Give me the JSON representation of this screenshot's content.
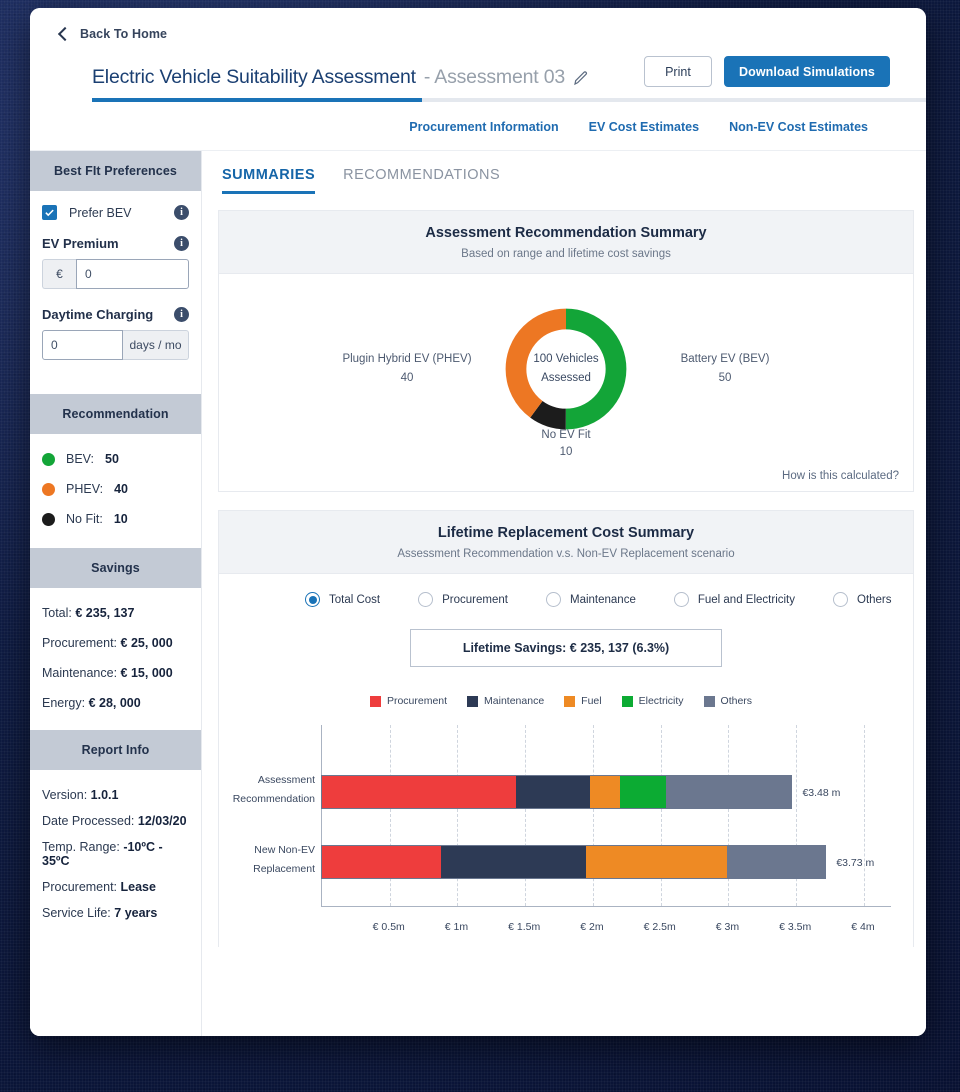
{
  "header": {
    "back_label": "Back To Home",
    "title_main": "Electric Vehicle Suitability Assessment",
    "title_sub": "- Assessment 03",
    "print_label": "Print",
    "download_label": "Download Simulations",
    "nav": [
      {
        "label": "Procurement Information"
      },
      {
        "label": "EV Cost Estimates"
      },
      {
        "label": "Non-EV Cost Estimates"
      }
    ]
  },
  "sidebar": {
    "preferences": {
      "title": "Best FIt Preferences",
      "prefer_bev_label": "Prefer BEV",
      "prefer_bev_checked": true,
      "ev_premium_label": "EV Premium",
      "ev_premium_currency": "€",
      "ev_premium_value": "0",
      "daytime_label": "Daytime Charging",
      "daytime_value": "0",
      "daytime_unit": "days / mo"
    },
    "recommendation": {
      "title": "Recommendation",
      "items": [
        {
          "label": "BEV:",
          "value": "50",
          "color": "#13a538"
        },
        {
          "label": "PHEV:",
          "value": "40",
          "color": "#ed7723"
        },
        {
          "label": "No Fit:",
          "value": "10",
          "color": "#1c1c1c"
        }
      ]
    },
    "savings": {
      "title": "Savings",
      "items": [
        {
          "label": "Total:",
          "value": "€ 235, 137"
        },
        {
          "label": "Procurement:",
          "value": "€ 25, 000"
        },
        {
          "label": "Maintenance:",
          "value": "€ 15, 000"
        },
        {
          "label": "Energy:",
          "value": "€ 28, 000"
        }
      ]
    },
    "report_info": {
      "title": "Report Info",
      "items": [
        {
          "label": "Version:",
          "value": "1.0.1"
        },
        {
          "label": "Date Processed:",
          "value": "12/03/20"
        },
        {
          "label": "Temp. Range:",
          "value": "-10ºC - 35ºC"
        },
        {
          "label": "Procurement:",
          "value": "Lease"
        },
        {
          "label": "Service Life:",
          "value": "7 years"
        }
      ]
    }
  },
  "main": {
    "tabs": [
      {
        "label": "SUMMARIES",
        "active": true
      },
      {
        "label": "RECOMMENDATIONS",
        "active": false
      }
    ],
    "panel1": {
      "title": "Assessment Recommendation Summary",
      "subtitle": "Based on range and lifetime cost savings",
      "calc_link": "How is this calculated?"
    },
    "panel2": {
      "title": "Lifetime Replacement Cost Summary",
      "subtitle": "Assessment Recommendation v.s. Non-EV Replacement scenario",
      "radios": [
        {
          "label": "Total Cost",
          "selected": true
        },
        {
          "label": "Procurement",
          "selected": false
        },
        {
          "label": "Maintenance",
          "selected": false
        },
        {
          "label": "Fuel and Electricity",
          "selected": false
        },
        {
          "label": "Others",
          "selected": false
        }
      ],
      "savings_box": "Lifetime Savings: € 235, 137 (6.3%)"
    }
  },
  "chart_data": [
    {
      "type": "pie",
      "title": "Assessment Recommendation Summary",
      "center_line1": "100 Vehicles",
      "center_line2": "Assessed",
      "total": 100,
      "categories": [
        "Battery EV (BEV)",
        "Plugin Hybrid EV (PHEV)",
        "No EV Fit"
      ],
      "values": [
        50,
        40,
        10
      ],
      "colors": [
        "#13a538",
        "#ed7723",
        "#1c1c1c"
      ],
      "labels": [
        {
          "name": "Battery EV (BEV)",
          "value": "50",
          "position": "right"
        },
        {
          "name": "Plugin Hybrid EV (PHEV)",
          "value": "40",
          "position": "left"
        },
        {
          "name": "No EV Fit",
          "value": "10",
          "position": "bottom"
        }
      ]
    },
    {
      "type": "bar",
      "orientation": "horizontal",
      "stacked": true,
      "title": "Lifetime Replacement Cost Summary",
      "xlabel": "",
      "ylabel": "",
      "xlim": [
        0,
        4.2
      ],
      "grid": true,
      "legend_position": "top",
      "tick_labels": [
        "€ 0.5m",
        "€ 1m",
        "€ 1.5m",
        "€ 2m",
        "€ 2.5m",
        "€ 3m",
        "€ 3.5m",
        "€ 4m"
      ],
      "tick_values": [
        0.5,
        1.0,
        1.5,
        2.0,
        2.5,
        3.0,
        3.5,
        4.0
      ],
      "categories": [
        {
          "line1": "Assessment",
          "line2": "Recommendation",
          "total_label": "€3.48 m",
          "total": 3.48
        },
        {
          "line1": "New Non-EV",
          "line2": "Replacement",
          "total_label": "€3.73 m",
          "total": 3.73
        }
      ],
      "series": [
        {
          "name": "Procurement",
          "color": "#ee3d3d",
          "values": [
            1.44,
            0.88
          ]
        },
        {
          "name": "Maintenance",
          "color": "#2d3a55",
          "values": [
            0.55,
            1.08
          ]
        },
        {
          "name": "Fuel",
          "color": "#ee8a24",
          "values": [
            0.22,
            1.04
          ]
        },
        {
          "name": "Electricity",
          "color": "#0cab33",
          "values": [
            0.34,
            0.0
          ]
        },
        {
          "name": "Others",
          "color": "#6b778f",
          "values": [
            0.93,
            0.73
          ]
        }
      ]
    }
  ]
}
